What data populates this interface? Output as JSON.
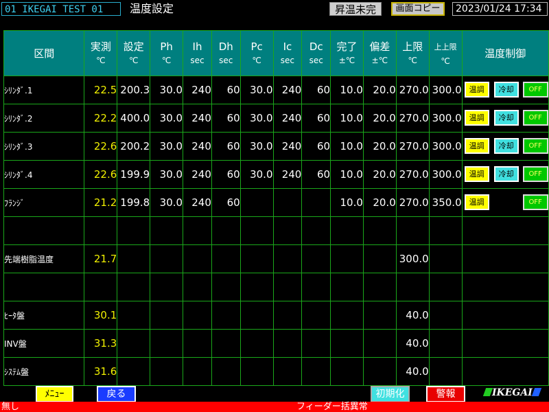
{
  "header": {
    "machine_id": "01  IKEGAI TEST 01",
    "screen_title": "温度設定",
    "status": "昇温未完",
    "copy_button": "画面コピー",
    "datetime": "2023/01/24  17:34"
  },
  "columns": [
    {
      "name": "区間",
      "unit": ""
    },
    {
      "name": "実測",
      "unit": "℃"
    },
    {
      "name": "設定",
      "unit": "℃"
    },
    {
      "name": "Ph",
      "unit": "℃"
    },
    {
      "name": "Ih",
      "unit": "sec"
    },
    {
      "name": "Dh",
      "unit": "sec"
    },
    {
      "name": "Pc",
      "unit": "℃"
    },
    {
      "name": "Ic",
      "unit": "sec"
    },
    {
      "name": "Dc",
      "unit": "sec"
    },
    {
      "name": "完了",
      "unit": "±℃"
    },
    {
      "name": "偏差",
      "unit": "±℃"
    },
    {
      "name": "上限",
      "unit": "℃"
    },
    {
      "name": "上上限",
      "unit": "℃"
    },
    {
      "name": "温度制御",
      "unit": ""
    }
  ],
  "control_labels": {
    "heat": "温調",
    "cool": "冷却",
    "off": "OFF"
  },
  "rows": [
    {
      "label": "ｼﾘﾝﾀﾞ.1",
      "cells": [
        "22.5",
        "200.3",
        "30.0",
        "240",
        "60",
        "30.0",
        "240",
        "60",
        "10.0",
        "20.0",
        "270.0",
        "300.0"
      ],
      "controls": [
        "heat",
        "cool",
        "off"
      ]
    },
    {
      "label": "ｼﾘﾝﾀﾞ.2",
      "cells": [
        "22.2",
        "400.0",
        "30.0",
        "240",
        "60",
        "30.0",
        "240",
        "60",
        "10.0",
        "20.0",
        "270.0",
        "300.0"
      ],
      "controls": [
        "heat",
        "cool",
        "off"
      ]
    },
    {
      "label": "ｼﾘﾝﾀﾞ.3",
      "cells": [
        "22.6",
        "200.2",
        "30.0",
        "240",
        "60",
        "30.0",
        "240",
        "60",
        "10.0",
        "20.0",
        "270.0",
        "300.0"
      ],
      "controls": [
        "heat",
        "cool",
        "off"
      ]
    },
    {
      "label": "ｼﾘﾝﾀﾞ.4",
      "cells": [
        "22.6",
        "199.9",
        "30.0",
        "240",
        "60",
        "30.0",
        "240",
        "60",
        "10.0",
        "20.0",
        "270.0",
        "300.0"
      ],
      "controls": [
        "heat",
        "cool",
        "off"
      ]
    },
    {
      "label": "ﾌﾗﾝｼﾞ",
      "cells": [
        "21.2",
        "199.8",
        "30.0",
        "240",
        "60",
        "",
        "",
        "",
        "10.0",
        "20.0",
        "270.0",
        "350.0"
      ],
      "controls": [
        "heat",
        "off"
      ]
    },
    {
      "label": "",
      "cells": [
        "",
        "",
        "",
        "",
        "",
        "",
        "",
        "",
        "",
        "",
        "",
        ""
      ],
      "controls": []
    },
    {
      "label": "先端樹脂温度",
      "cells": [
        "21.7",
        "",
        "",
        "",
        "",
        "",
        "",
        "",
        "",
        "",
        "300.0",
        ""
      ],
      "controls": []
    },
    {
      "label": "",
      "cells": [
        "",
        "",
        "",
        "",
        "",
        "",
        "",
        "",
        "",
        "",
        "",
        ""
      ],
      "controls": []
    },
    {
      "label": "ﾋｰﾀ盤",
      "cells": [
        "30.1",
        "",
        "",
        "",
        "",
        "",
        "",
        "",
        "",
        "",
        "40.0",
        ""
      ],
      "controls": []
    },
    {
      "label": "INV盤",
      "cells": [
        "31.3",
        "",
        "",
        "",
        "",
        "",
        "",
        "",
        "",
        "",
        "40.0",
        ""
      ],
      "controls": []
    },
    {
      "label": "ｼｽﾃﾑ盤",
      "cells": [
        "31.6",
        "",
        "",
        "",
        "",
        "",
        "",
        "",
        "",
        "",
        "40.0",
        ""
      ],
      "controls": []
    }
  ],
  "footer": {
    "menu_button": "ﾒﾆｭｰ",
    "back_button": "戻る",
    "init_button": "初期化",
    "alarm_button": "警報",
    "logo_text": "IKEGAI",
    "alarm_left": "無し",
    "alarm_message": "フィーダー括異常"
  },
  "colors": {
    "header_bg": "#007f7f",
    "grid_line": "#1aa81a",
    "actual_value": "#f0f000",
    "heat_button": "#ffff00",
    "cool_button": "#40e0e0",
    "off_button": "#00c800",
    "alarm_bar": "#ff0000"
  }
}
